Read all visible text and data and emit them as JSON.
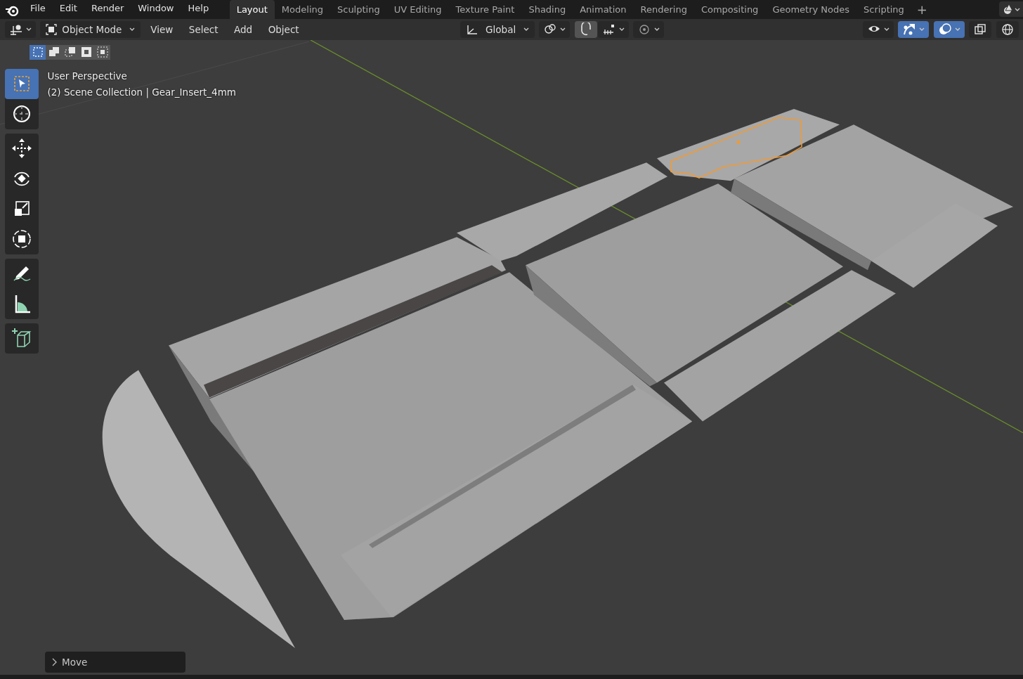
{
  "menu": [
    "File",
    "Edit",
    "Render",
    "Window",
    "Help"
  ],
  "workspaces": [
    {
      "label": "Layout",
      "selected": true
    },
    {
      "label": "Modeling",
      "selected": false
    },
    {
      "label": "Sculpting",
      "selected": false
    },
    {
      "label": "UV Editing",
      "selected": false
    },
    {
      "label": "Texture Paint",
      "selected": false
    },
    {
      "label": "Shading",
      "selected": false
    },
    {
      "label": "Animation",
      "selected": false
    },
    {
      "label": "Rendering",
      "selected": false
    },
    {
      "label": "Compositing",
      "selected": false
    },
    {
      "label": "Geometry Nodes",
      "selected": false
    },
    {
      "label": "Scripting",
      "selected": false
    }
  ],
  "add_workspace": "+",
  "header": {
    "mode": "Object Mode",
    "menus": [
      "View",
      "Select",
      "Add",
      "Object"
    ],
    "orientation": "Global",
    "center_tools": [
      {
        "kind": "pivot",
        "on": false
      },
      {
        "kind": "snap",
        "on": true
      },
      {
        "kind": "snap-target",
        "on": false
      },
      {
        "kind": "proportional",
        "on": false
      }
    ],
    "right_tools": [
      {
        "kind": "visibility",
        "on": false
      },
      {
        "kind": "gizmo",
        "on": true
      },
      {
        "kind": "overlay",
        "on": true
      },
      {
        "kind": "xray",
        "on": false
      },
      {
        "kind": "wireframe",
        "on": false
      }
    ]
  },
  "select_modes": [
    {
      "selected": true
    },
    {
      "selected": false
    },
    {
      "selected": false
    },
    {
      "selected": false
    },
    {
      "selected": false
    }
  ],
  "tool_groups": [
    [
      {
        "kind": "select",
        "selected": true
      },
      {
        "kind": "cursor",
        "selected": false
      }
    ],
    [
      {
        "kind": "move",
        "selected": false
      },
      {
        "kind": "rotate",
        "selected": false
      },
      {
        "kind": "scale",
        "selected": false
      },
      {
        "kind": "transform",
        "selected": false
      }
    ],
    [
      {
        "kind": "annotate",
        "selected": false
      },
      {
        "kind": "measure",
        "selected": false
      }
    ],
    [
      {
        "kind": "add-cube",
        "selected": false
      }
    ]
  ],
  "viewport": {
    "view": "User Perspective",
    "collection": "(2) Scene Collection | Gear_Insert_4mm"
  },
  "last_operator": "Move"
}
